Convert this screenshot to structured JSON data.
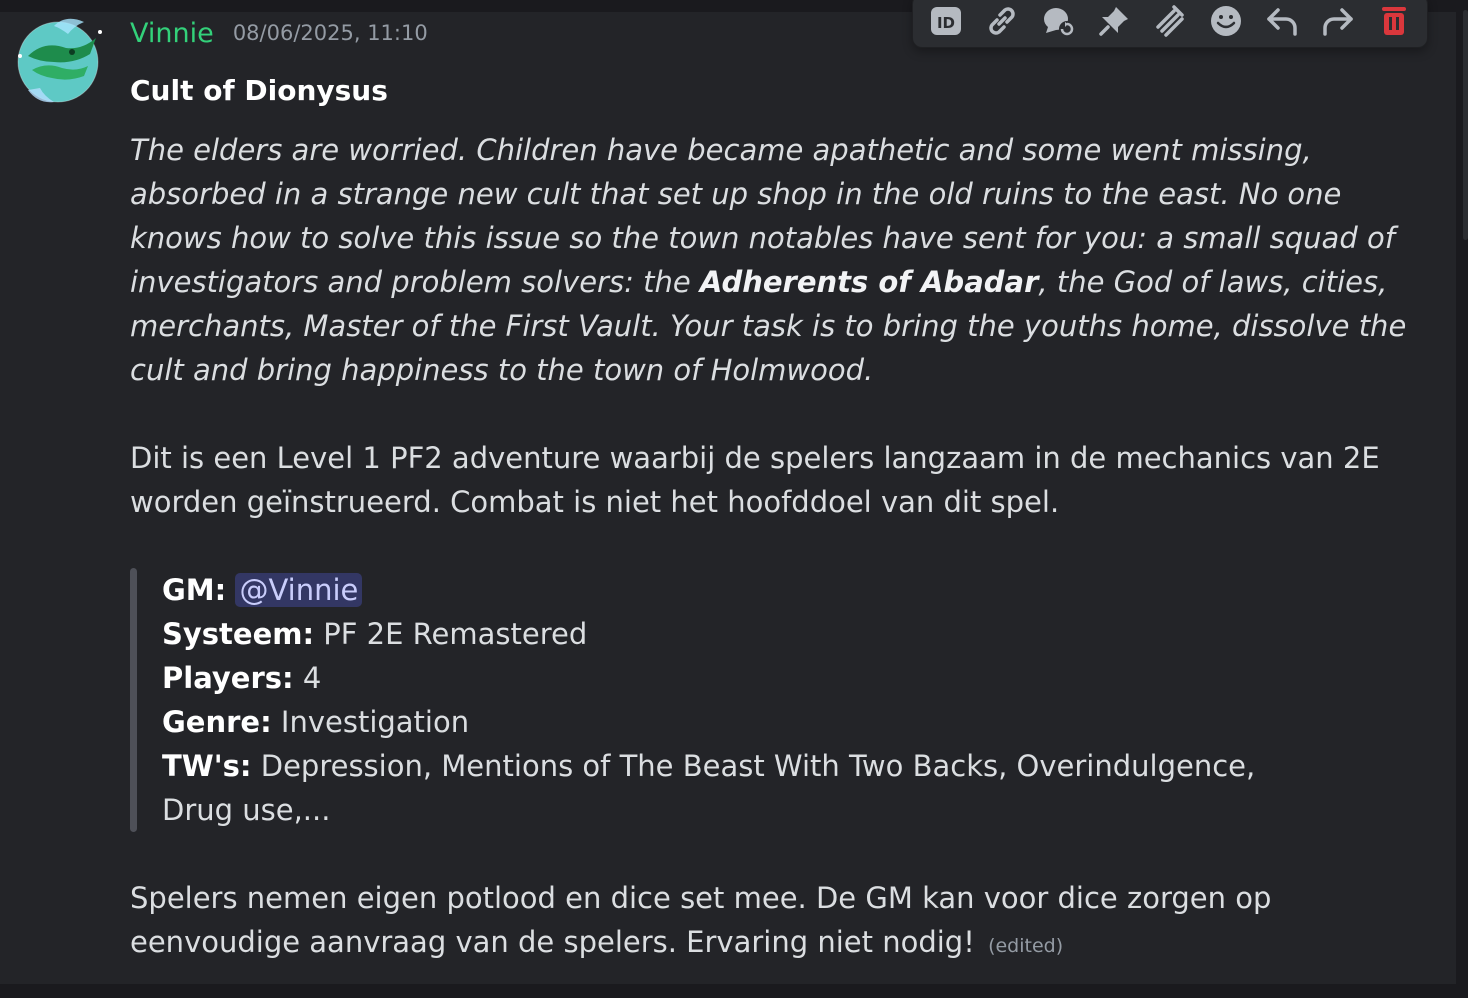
{
  "message": {
    "username": "Vinnie",
    "timestamp": "08/06/2025, 11:10",
    "title": "Cult of Dionysus",
    "intro": {
      "before": "The elders are worried. Children have became apathetic and some went missing, absorbed in a strange new cult that set up shop in the old ruins to the east. No one knows how to solve this issue so the town notables have sent for you: a small squad of investigators and problem solvers: the ",
      "bold": "Adherents of Abadar",
      "after": ", the God of laws, cities, merchants,  Master of the First Vault. Your task is to bring the youths home, dissolve the cult and bring happiness to the town of Holmwood."
    },
    "dutch_paragraph": "Dit is een Level 1 PF2 adventure waarbij de spelers langzaam in de mechanics van 2E worden geïnstrueerd. Combat is niet het hoofddoel van dit spel.",
    "quote": {
      "gm_label": "GM:",
      "gm_mention": "@Vinnie",
      "system_label": "Systeem:",
      "system_value": "PF 2E Remastered",
      "players_label": "Players:",
      "players_value": "4",
      "genre_label": "Genre:",
      "genre_value": "Investigation",
      "tw_label": "TW's:",
      "tw_value": "Depression, Mentions of The Beast With Two Backs, Overindulgence, Drug use,..."
    },
    "closing": "Spelers nemen eigen potlood en dice set mee. De GM kan voor dice zorgen op eenvoudige aanvraag van de spelers. Ervaring niet nodig!",
    "edited_label": "(edited)"
  },
  "toolbar": {
    "icons": [
      "id-icon",
      "link-icon",
      "thread-icon",
      "pin-icon",
      "mark-unread-icon",
      "emoji-icon",
      "reply-icon",
      "forward-icon",
      "delete-icon"
    ],
    "colors": {
      "icon": "#b5bac1",
      "delete": "#da373c"
    }
  },
  "colors": {
    "username": "#33d17a",
    "background": "#232428",
    "mention_bg": "#3c4270",
    "mention_text": "#c9cdfb"
  }
}
